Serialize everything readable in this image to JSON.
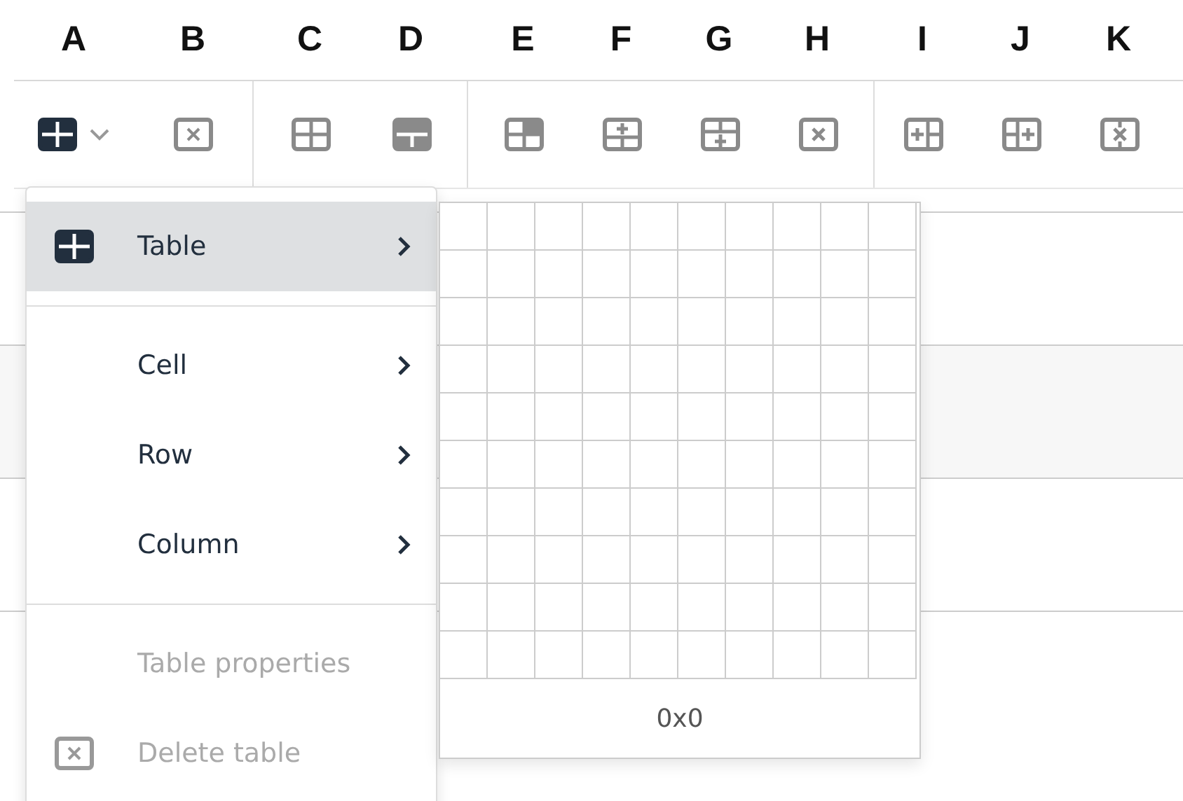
{
  "toolbar": {
    "groups": [
      {
        "buttons": [
          {
            "letter": "A",
            "active": true,
            "dropdown": true
          },
          {
            "letter": "B",
            "active": false,
            "dropdown": false
          }
        ]
      },
      {
        "buttons": [
          {
            "letter": "C",
            "active": false,
            "dropdown": false
          },
          {
            "letter": "D",
            "active": false,
            "dropdown": false
          }
        ]
      },
      {
        "buttons": [
          {
            "letter": "E",
            "active": false,
            "dropdown": false
          },
          {
            "letter": "F",
            "active": false,
            "dropdown": false
          },
          {
            "letter": "G",
            "active": false,
            "dropdown": false
          },
          {
            "letter": "H",
            "active": false,
            "dropdown": false
          }
        ]
      },
      {
        "buttons": [
          {
            "letter": "I",
            "active": false,
            "dropdown": false
          },
          {
            "letter": "J",
            "active": false,
            "dropdown": false
          },
          {
            "letter": "K",
            "active": false,
            "dropdown": false
          }
        ]
      }
    ]
  },
  "menu": {
    "sections": [
      {
        "items": [
          {
            "label": "Table",
            "selected": true,
            "disabled": false,
            "submenu": true,
            "icon": true
          }
        ]
      },
      {
        "items": [
          {
            "label": "Cell",
            "selected": false,
            "disabled": false,
            "submenu": true,
            "icon": false
          },
          {
            "label": "Row",
            "selected": false,
            "disabled": false,
            "submenu": true,
            "icon": false
          },
          {
            "label": "Column",
            "selected": false,
            "disabled": false,
            "submenu": true,
            "icon": false
          }
        ]
      },
      {
        "items": [
          {
            "label": "Table properties",
            "selected": false,
            "disabled": true,
            "submenu": false,
            "icon": false
          },
          {
            "label": "Delete table",
            "selected": false,
            "disabled": true,
            "submenu": false,
            "icon": true
          }
        ]
      }
    ]
  },
  "grid_picker": {
    "size_label": "0x0"
  }
}
